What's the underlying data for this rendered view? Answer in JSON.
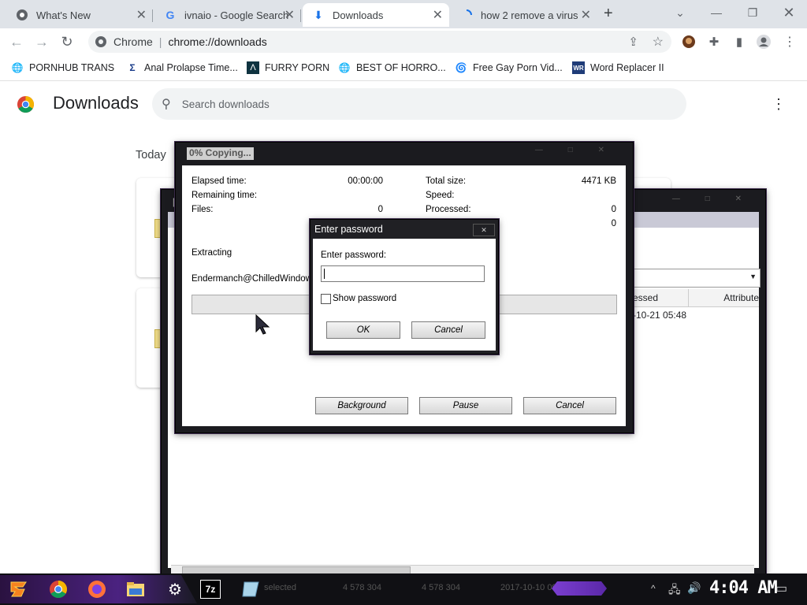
{
  "tabs": [
    {
      "title": "What's New",
      "icon": "chrome-icon",
      "active": false
    },
    {
      "title": "ivnaio - Google Search",
      "icon": "google-icon",
      "active": false
    },
    {
      "title": "Downloads",
      "icon": "download-icon",
      "active": true
    },
    {
      "title": "how 2 remove a virus",
      "icon": "loading-spinner-icon",
      "active": false
    }
  ],
  "omnibox": {
    "site_label": "Chrome",
    "url": "chrome://downloads"
  },
  "bookmarks": [
    {
      "label": "PORNHUB TRANS",
      "icon": "globe-icon"
    },
    {
      "label": "Anal Prolapse Time...",
      "icon": "sigma-icon"
    },
    {
      "label": "FURRY PORN",
      "icon": "lambda-icon"
    },
    {
      "label": "BEST OF HORRO...",
      "icon": "globe-icon"
    },
    {
      "label": "Free Gay Porn Vid...",
      "icon": "spiral-icon"
    },
    {
      "label": "Word Replacer II",
      "icon": "word-replacer-icon"
    }
  ],
  "downloads": {
    "title": "Downloads",
    "search_placeholder": "Search downloads",
    "section_today": "Today"
  },
  "archive_window": {
    "col_accessed": "essed",
    "col_attributes": "Attribute",
    "row_date": "-10-21 05:48",
    "status_size1": "4 578 304",
    "status_size2": "4 578 304",
    "status_date": "2017-10-10 09:",
    "status_selected": "selected"
  },
  "copy_dialog": {
    "title": "0% Copying...",
    "elapsed_label": "Elapsed time:",
    "elapsed_value": "00:00:00",
    "remaining_label": "Remaining time:",
    "files_label": "Files:",
    "files_value": "0",
    "total_size_label": "Total size:",
    "total_size_value": "4471 KB",
    "speed_label": "Speed:",
    "processed_label": "Processed:",
    "processed_value": "0",
    "extra_value": "0",
    "extracting_label": "Extracting",
    "file_path": "Endermanch@ChilledWindows.e",
    "progress": 0,
    "background_label": "Background",
    "pause_label": "Pause",
    "cancel_label": "Cancel"
  },
  "password_dialog": {
    "title": "Enter password",
    "prompt": "Enter password:",
    "value": "",
    "show_password_label": "Show password",
    "show_password_checked": false,
    "ok_label": "OK",
    "cancel_label": "Cancel"
  },
  "taskbar": {
    "clock": "4:04 AM",
    "apps": [
      "start-icon",
      "chrome-icon",
      "firefox-icon",
      "file-explorer-icon",
      "settings-icon",
      "7zip-icon",
      "app-icon"
    ]
  },
  "colors": {
    "accent_purple": "#6a2fbf",
    "chrome_frame": "#dfe3e8",
    "dark_frame": "#1b1b1f"
  }
}
